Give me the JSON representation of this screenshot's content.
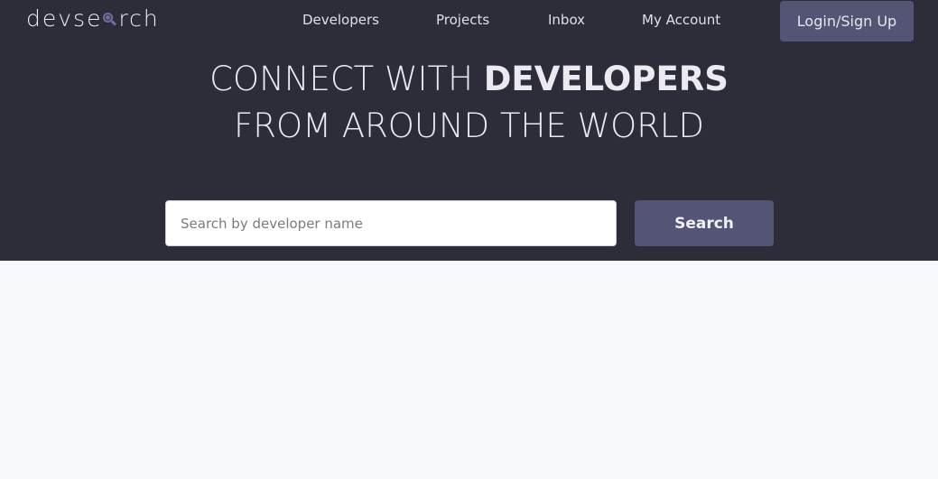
{
  "brand": {
    "prefix": "devse",
    "suffix": "rch",
    "icon": "search-icon",
    "accent": "#6f6ea0"
  },
  "nav": {
    "items": [
      {
        "label": "Developers"
      },
      {
        "label": "Projects"
      },
      {
        "label": "Inbox"
      },
      {
        "label": "My Account"
      }
    ],
    "login_label": "Login/Sign Up"
  },
  "hero": {
    "line1_light": "CONNECT WITH ",
    "line1_bold": "DEVELOPERS",
    "line2": "FROM AROUND THE WORLD"
  },
  "search": {
    "placeholder": "Search by developer name",
    "value": "",
    "button_label": "Search"
  },
  "colors": {
    "hero_bg": "#2d2d39",
    "button_bg": "#545575",
    "page_bg": "#f8f9fd"
  }
}
